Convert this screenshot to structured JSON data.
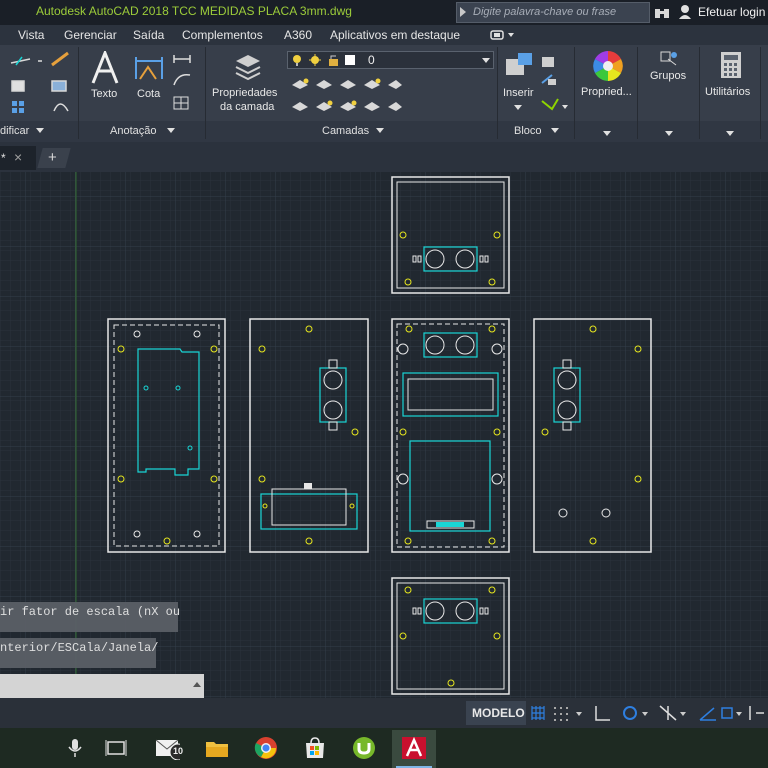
{
  "title_bar": {
    "app_title": "Autodesk AutoCAD 2018    TCC MEDIDAS PLACA 3mm.dwg",
    "search_placeholder": "Digite palavra-chave ou frase",
    "login_label": "Efetuar login"
  },
  "menu": {
    "items": [
      "Vista",
      "Gerenciar",
      "Saída",
      "Complementos",
      "A360",
      "Aplicativos em destaque"
    ]
  },
  "ribbon": {
    "texto_label": "Texto",
    "cota_label": "Cota",
    "layer_props_line1": "Propriedades",
    "layer_props_line2": "da camada",
    "layer_value": "0",
    "inserir_label": "Inserir",
    "propriedades_label": "Propried...",
    "grupos_label": "Grupos",
    "utilitarios_label": "Utilitários",
    "panels": {
      "modificar": "dificar",
      "anotacao": "Anotação",
      "camadas": "Camadas",
      "bloco": "Bloco"
    }
  },
  "tabs": {
    "drawing_tab_suffix": "*",
    "close_glyph": "×",
    "add_glyph": "+"
  },
  "command_line": {
    "history_1": "ir fator de escala (nX ou",
    "history_2": "nterior/ESCala/Janela/",
    "input_value": ""
  },
  "status_bar": {
    "model_label": "MODELO"
  },
  "taskbar": {
    "mail_badge": "10"
  },
  "colors": {
    "accent_green": "#8fd400",
    "cyan": "#19d5d5",
    "yellow": "#e6e61e",
    "background": "#212830"
  }
}
